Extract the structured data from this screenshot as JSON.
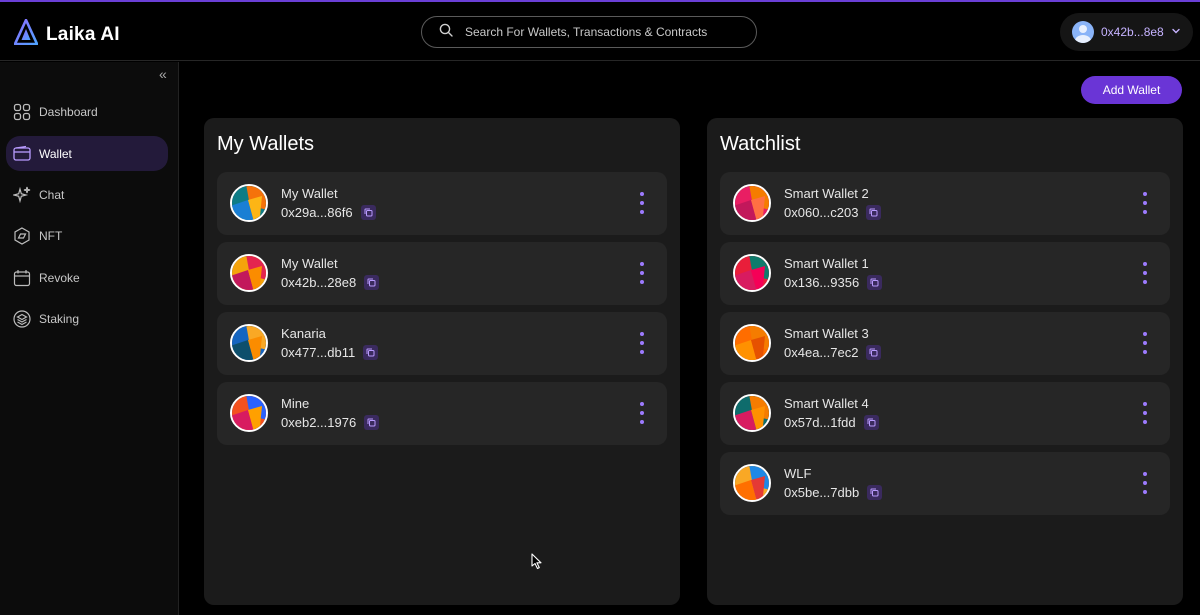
{
  "app": {
    "name": "Laika AI"
  },
  "search": {
    "placeholder": "Search For Wallets, Transactions & Contracts"
  },
  "account": {
    "address": "0x42b...8e8"
  },
  "sidebar": {
    "items": [
      {
        "label": "Dashboard",
        "icon": "dashboard-grid-icon"
      },
      {
        "label": "Wallet",
        "icon": "wallet-icon",
        "active": true
      },
      {
        "label": "Chat",
        "icon": "sparkle-icon"
      },
      {
        "label": "NFT",
        "icon": "nft-icon"
      },
      {
        "label": "Revoke",
        "icon": "calendar-icon"
      },
      {
        "label": "Staking",
        "icon": "stack-icon"
      }
    ]
  },
  "actions": {
    "add_wallet": "Add Wallet"
  },
  "my_wallets": {
    "title": "My Wallets",
    "items": [
      {
        "name": "My Wallet",
        "address": "0x29a...86f6",
        "colors": [
          "#0e7c86",
          "#f5720b",
          "#1a7fd4",
          "#fdb515"
        ]
      },
      {
        "name": "My Wallet",
        "address": "0x42b...28e8",
        "colors": [
          "#f5a30b",
          "#e4244f",
          "#c2185b",
          "#fb8c00"
        ]
      },
      {
        "name": "Kanaria",
        "address": "0x477...db11",
        "colors": [
          "#1565c0",
          "#f9a825",
          "#0d4f6c",
          "#fb8c00"
        ]
      },
      {
        "name": "Mine",
        "address": "0xeb2...1976",
        "colors": [
          "#f4511e",
          "#2962ff",
          "#d81b60",
          "#ffa000"
        ]
      }
    ]
  },
  "watchlist": {
    "title": "Watchlist",
    "items": [
      {
        "name": "Smart Wallet 2",
        "address": "0x060...c203",
        "colors": [
          "#e91e63",
          "#f57c00",
          "#c2185b",
          "#ff7043"
        ]
      },
      {
        "name": "Smart Wallet 1",
        "address": "0x136...9356",
        "colors": [
          "#e91e3a",
          "#0f7b6c",
          "#d81b60",
          "#f50057"
        ]
      },
      {
        "name": "Smart Wallet 3",
        "address": "0x4ea...7ec2",
        "colors": [
          "#ff6d00",
          "#f57c00",
          "#ff9100",
          "#e65100"
        ]
      },
      {
        "name": "Smart Wallet 4",
        "address": "0x57d...1fdd",
        "colors": [
          "#0e6c6c",
          "#f57c00",
          "#d81b60",
          "#ff9100"
        ]
      },
      {
        "name": "WLF",
        "address": "0x5be...7dbb",
        "colors": [
          "#f9a825",
          "#1e88e5",
          "#ff6f00",
          "#e53935"
        ]
      }
    ]
  },
  "colors": {
    "accent": "#6a35d6",
    "panel": "#1b1b1b",
    "card": "#262626",
    "active_nav": "#231a3a"
  }
}
